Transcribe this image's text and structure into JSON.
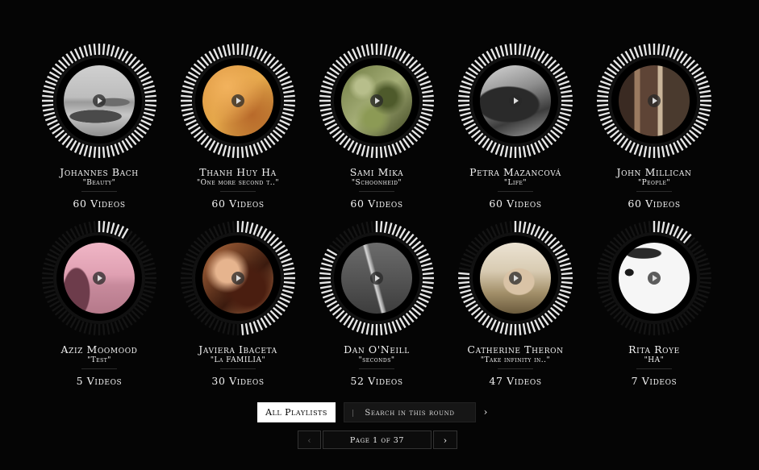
{
  "playlists": [
    {
      "author": "Johannes Bach",
      "title": "\"Beauty\"",
      "videos": "60 Videos",
      "dial_fill": 1.0,
      "thumb": "bach",
      "accent": "#cfcfcf"
    },
    {
      "author": "Thanh Huy Ha",
      "title": "\"One more second t..\"",
      "videos": "60 Videos",
      "dial_fill": 1.0,
      "thumb": "ha",
      "accent": "#d9953e"
    },
    {
      "author": "Sami Mika",
      "title": "\"Schoonheid\"",
      "videos": "60 Videos",
      "dial_fill": 1.0,
      "thumb": "mika",
      "accent": "#7f8d57"
    },
    {
      "author": "Petra Mazancová",
      "title": "\"Life\"",
      "videos": "60 Videos",
      "dial_fill": 1.0,
      "thumb": "petra",
      "accent": "#8c8c8c"
    },
    {
      "author": "John Millican",
      "title": "\"People\"",
      "videos": "60 Videos",
      "dial_fill": 1.0,
      "thumb": "millican",
      "accent": "#8a6a4e"
    },
    {
      "author": "Aziz Moomood",
      "title": "\"Test\"",
      "videos": "5 Videos",
      "dial_fill": 0.1,
      "thumb": "aziz",
      "accent": "#d9a5b3"
    },
    {
      "author": "Javiera Ibaceta",
      "title": "\"La FAMILIA\"",
      "videos": "30 Videos",
      "dial_fill": 0.5,
      "thumb": "javiera",
      "accent": "#9b5a36"
    },
    {
      "author": "Dan O'Neill",
      "title": "\"seconds\"",
      "videos": "52 Videos",
      "dial_fill": 0.85,
      "thumb": "dan",
      "accent": "#6b6b6b"
    },
    {
      "author": "Catherine Theron",
      "title": "\"Take infinity in..\"",
      "videos": "47 Videos",
      "dial_fill": 0.78,
      "thumb": "catherine",
      "accent": "#b9a27e"
    },
    {
      "author": "Rita Roye",
      "title": "\"HA\"",
      "videos": "7 Videos",
      "dial_fill": 0.12,
      "thumb": "rita",
      "accent": "#f4f4f4"
    }
  ],
  "controls": {
    "all_playlists": "All Playlists",
    "search_round": "Search in this round",
    "next_icon": "chevron-right-icon"
  },
  "pager": {
    "label": "Page 1 of 37",
    "prev_icon": "chevron-left-icon",
    "next_icon": "chevron-right-icon"
  }
}
